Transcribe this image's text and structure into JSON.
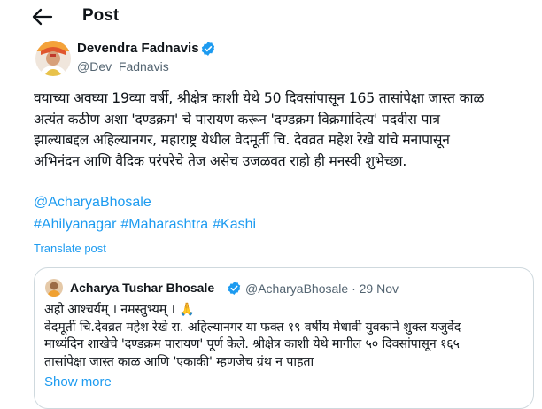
{
  "header": {
    "title": "Post",
    "back_icon": "arrow-left-icon"
  },
  "post": {
    "author": {
      "name": "Devendra Fadnavis",
      "handle": "@Dev_Fadnavis",
      "verified_icon": "verified-badge-icon"
    },
    "text": "वयाच्या अवघ्या 19व्या वर्षी, श्रीक्षेत्र काशी येथे 50 दिवसांपासून 165 तासांपेक्षा जास्त काळ\nअत्यंत कठीण अशा 'दण्डक्रम' चे पारायण करून 'दण्डक्रम विक्रमादित्य' पदवीस पात्र\nझाल्याबद्दल अहिल्यानगर, महाराष्ट्र येथील वेदमूर्ती चि. देवव्रत महेश रेखे यांचे मनापासून\nअभिनंदन आणि वैदिक परंपरेचे तेज असेच उजळवत राहो ही मनस्वी शुभेच्छा.",
    "mention": "@AcharyaBhosale",
    "hashtags": [
      "#Ahilyanagar",
      "#Maharashtra",
      "#Kashi"
    ],
    "translate_label": "Translate post"
  },
  "quote": {
    "author": {
      "name": "Acharya Tushar Bhosale",
      "handle": "@AcharyaBhosale",
      "separator": "·",
      "date": "29 Nov",
      "verified_icon": "verified-badge-icon"
    },
    "text": "अहो आश्चर्यम् । नमस्तुभ्यम् । 🙏\nवेदमूर्ती चि.देवव्रत महेश रेखे रा. अहिल्यानगर या फक्त १९ वर्षीय मेधावी युवकाने शुक्ल यजुर्वेद\nमाध्यंदिन शाखेचे 'दण्डक्रम पारायण' पूर्ण केले. श्रीक्षेत्र काशी येथे मागील ५० दिवसांपासून १६५\nतासांपेक्षा जास्त काळ आणि 'एकाकी' म्हणजेच ग्रंथ न पाहता",
    "show_more_label": "Show more"
  },
  "colors": {
    "link": "#1d9bf0",
    "secondary_text": "#536471",
    "border": "#cfd9de",
    "verified": "#1d9bf0"
  }
}
